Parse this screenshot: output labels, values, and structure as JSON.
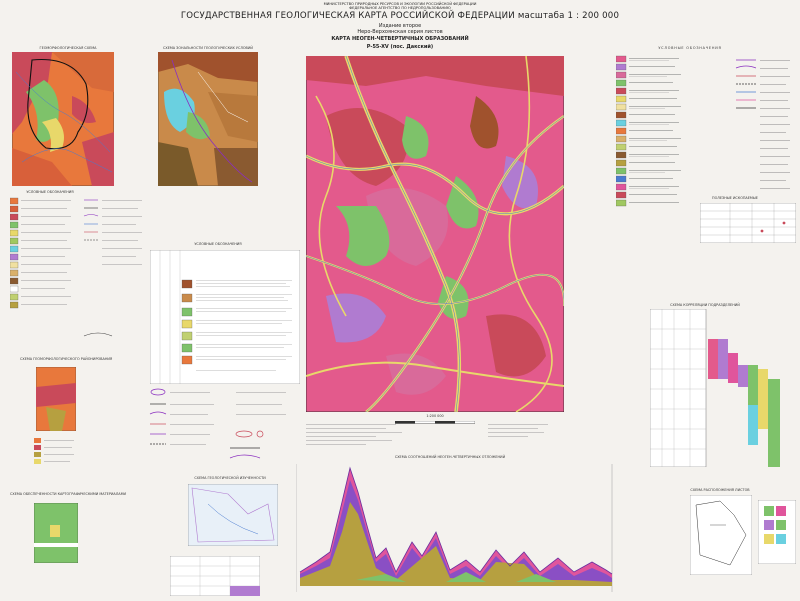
{
  "header": {
    "ministry_line1": "МИНИСТЕРСТВО ПРИРОДНЫХ РЕСУРСОВ И ЭКОЛОГИИ РОССИЙСКОЙ ФЕДЕРАЦИИ",
    "ministry_line2": "ФЕДЕРАЛЬНОЕ АГЕНТСТВО ПО НЕДРОПОЛЬЗОВАНИЮ",
    "title": "ГОСУДАРСТВЕННАЯ ГЕОЛОГИЧЕСКАЯ КАРТА РОССИЙСКОЙ ФЕДЕРАЦИИ масштаба 1 : 200 000",
    "edition": "Издание второе",
    "series": "Нерo-Верхоянская серия листов",
    "map_name": "КАРТА НЕОГЕН-ЧЕТВЕРТИЧНЫХ ОБРАЗОВАНИЙ",
    "sheet": "P-55-XV (пос. Дакский)"
  },
  "panels": {
    "left_top_title": "ГЕОМОРФОЛОГИЧЕСКАЯ СХЕМА",
    "left_mid_title": "СХЕМА ЗОНАЛЬНОСТИ ГЕОЛОГИЧЕСКИХ УСЛОВИЙ",
    "legend_left_title": "УСЛОВНЫЕ ОБОЗНАЧЕНИЯ",
    "legend_right_title": "УСЛОВНЫЕ ОБОЗНАЧЕНИЯ",
    "legend_mid_title": "УСЛОВНЫЕ ОБОЗНАЧЕНИЯ",
    "profile_title": "СХЕМА СООТНОШЕНИЙ НЕОГЕН-ЧЕТВЕРТИЧНЫХ ОТЛОЖЕНИЙ",
    "scale_text": "1:200 000",
    "correlation_title": "СХЕМА КОРРЕЛЯЦИИ ПОДРАЗДЕЛЕНИЙ",
    "index_title": "СХЕМА РАСПОЛОЖЕНИЯ ЛИСТОВ",
    "small_scheme_title": "СХЕМА ГЕОМОРФОЛОГИЧЕСКОГО РАЙОНИРОВАНИЯ",
    "bottom_left_title": "СХЕМА ОБЕСПЕЧЕННОСТИ КАРТОГРАФИЧЕСКИМИ МАТЕРИАЛАМИ",
    "mid_bottom_title": "СХЕМА ГЕОЛОГИЧЕСКОЙ ИЗУЧЕННОСТИ",
    "right_mid_title": "ПОЛЕЗНЫЕ ИСКОПАЕМЫЕ"
  },
  "colors": {
    "map_pink": "#e35a8c",
    "map_red": "#c94a5a",
    "map_brown": "#a0522d",
    "map_green": "#7ec26a",
    "map_yellow": "#e8d86a",
    "map_violet": "#b07bd0",
    "geomorph_orange": "#e8783c",
    "profile_pink": "#e0559c",
    "profile_violet": "#8a4fc4",
    "profile_olive": "#b6a040"
  }
}
